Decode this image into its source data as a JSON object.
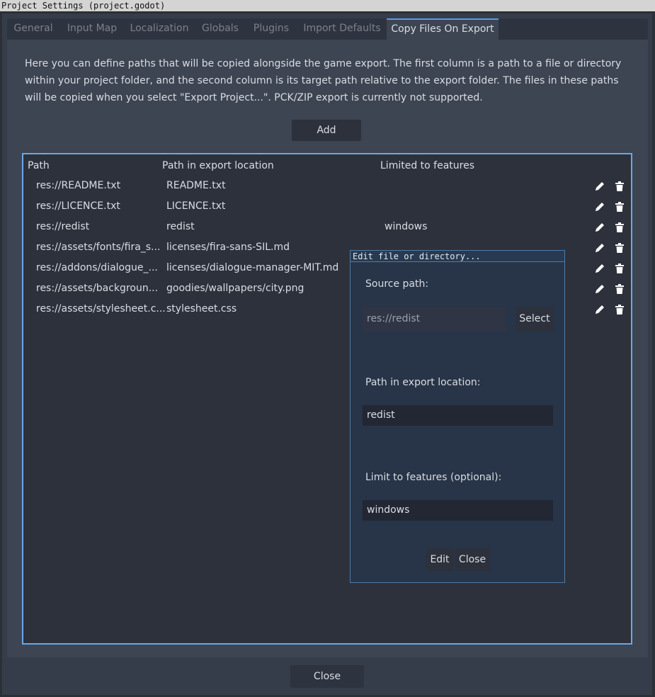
{
  "window": {
    "title": "Project Settings (project.godot)"
  },
  "tabs": [
    {
      "label": "General"
    },
    {
      "label": "Input Map"
    },
    {
      "label": "Localization"
    },
    {
      "label": "Globals"
    },
    {
      "label": "Plugins"
    },
    {
      "label": "Import Defaults"
    },
    {
      "label": "Copy Files On Export",
      "active": true
    }
  ],
  "description": "Here you can define paths that will be copied alongside the game export. The first column is a path to a file or directory within your project folder, and the second column is its target path relative to the export folder. The files in these paths will be copied when you select \"Export Project...\". PCK/ZIP export is currently not supported.",
  "add_button": "Add",
  "table": {
    "headers": [
      "Path",
      "Path in export location",
      "Limited to features"
    ],
    "rows": [
      {
        "path": "res://README.txt",
        "target": "README.txt",
        "features": ""
      },
      {
        "path": "res://LICENCE.txt",
        "target": "LICENCE.txt",
        "features": ""
      },
      {
        "path": "res://redist",
        "target": "redist",
        "features": "windows"
      },
      {
        "path": "res://assets/fonts/fira_s...",
        "target": "licenses/fira-sans-SIL.md",
        "features": ""
      },
      {
        "path": "res://addons/dialogue_...",
        "target": "licenses/dialogue-manager-MIT.md",
        "features": ""
      },
      {
        "path": "res://assets/backgroun...",
        "target": "goodies/wallpapers/city.png",
        "features": ""
      },
      {
        "path": "res://assets/stylesheet.c...",
        "target": "stylesheet.css",
        "features": ""
      }
    ],
    "row_icons": [
      "pencil-icon",
      "trash-icon"
    ]
  },
  "dialog": {
    "title": "Edit file or directory...",
    "source_label": "Source path:",
    "source_value": "res://redist",
    "select_button": "Select",
    "target_label": "Path in export location:",
    "target_value": "redist",
    "features_label": "Limit to features (optional):",
    "features_value": "windows",
    "edit_button": "Edit",
    "close_button": "Close"
  },
  "close_button": "Close",
  "colors": {
    "accent": "#6aa8e6",
    "background": "#363d4a",
    "panel": "#3d4452"
  }
}
